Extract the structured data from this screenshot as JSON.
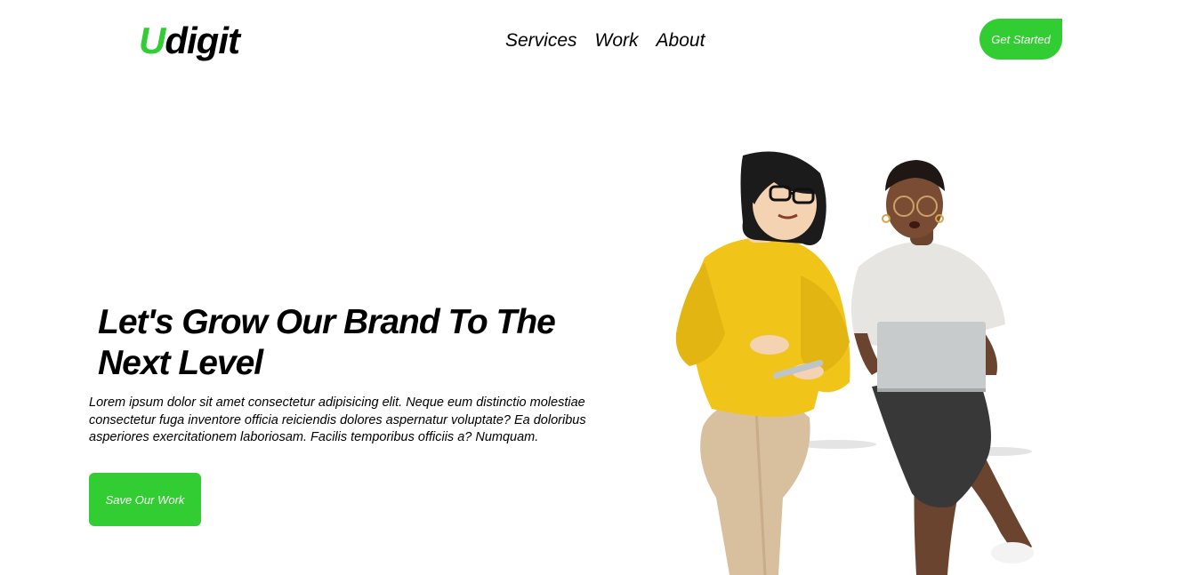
{
  "brand": {
    "logo_first": "U",
    "logo_rest": "digit",
    "accent": "#32cd32"
  },
  "nav": {
    "items": [
      "Services",
      "Work",
      "About"
    ]
  },
  "header": {
    "cta_label": "Get Started"
  },
  "hero": {
    "title": "Let's Grow Our Brand To The Next Level",
    "description": "Lorem ipsum dolor sit amet consectetur adipisicing elit. Neque eum distinctio molestiae consectetur fuga inventore officia reiciendis dolores aspernatur voluptate? Ea doloribus asperiores exercitationem laboriosam. Facilis temporibus officiis a? Numquam.",
    "button_label": "Save Our Work"
  }
}
